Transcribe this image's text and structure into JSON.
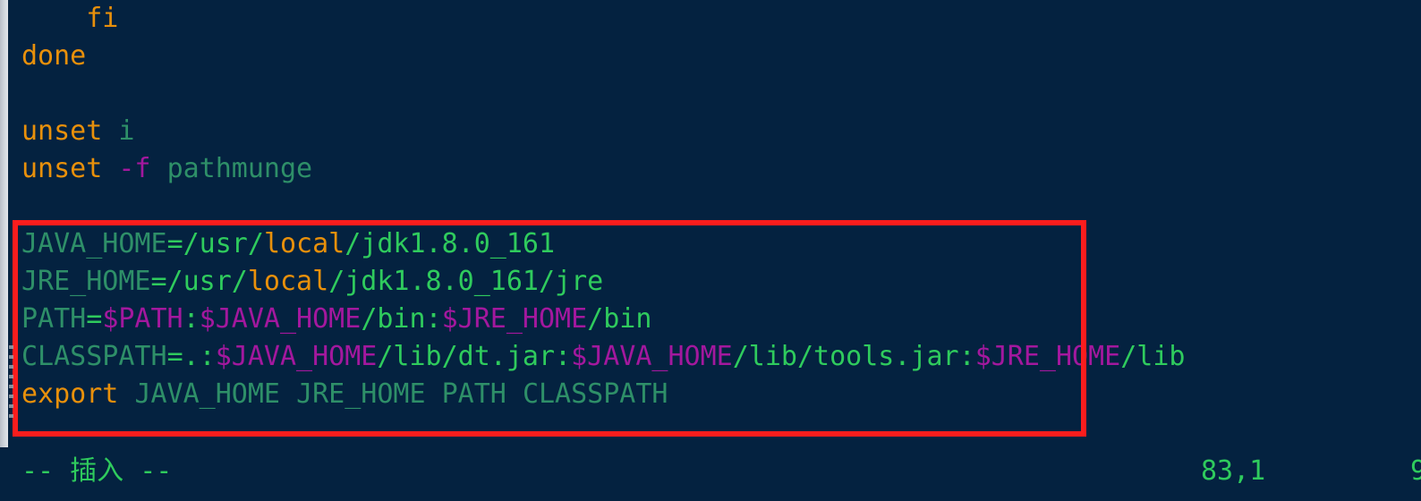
{
  "editor": {
    "app": "vim",
    "background_color": "#042240",
    "colors": {
      "keyword": "#e8900b",
      "identifier": "#2e8f68",
      "string": "#2fcb5d",
      "variable": "#a3189e",
      "annotation": "#fb1d1d",
      "scrollbar": "#c7ccd3"
    },
    "lines": [
      {
        "id": "line-fi",
        "indent": "    ",
        "tokens": [
          {
            "text": "fi",
            "kind": "keyword"
          }
        ]
      },
      {
        "id": "line-done",
        "indent": "",
        "tokens": [
          {
            "text": "done",
            "kind": "keyword"
          }
        ]
      },
      {
        "id": "line-blank-1",
        "indent": "",
        "tokens": []
      },
      {
        "id": "line-unset-i",
        "indent": "",
        "tokens": [
          {
            "text": "unset",
            "kind": "keyword"
          },
          {
            "text": " ",
            "kind": "plain"
          },
          {
            "text": "i",
            "kind": "identifier"
          }
        ]
      },
      {
        "id": "line-unset-f-pathmunge",
        "indent": "",
        "tokens": [
          {
            "text": "unset",
            "kind": "keyword"
          },
          {
            "text": " ",
            "kind": "plain"
          },
          {
            "text": "-f",
            "kind": "flag"
          },
          {
            "text": " ",
            "kind": "plain"
          },
          {
            "text": "pathmunge",
            "kind": "identifier"
          }
        ]
      },
      {
        "id": "line-blank-2",
        "indent": "",
        "tokens": []
      },
      {
        "id": "line-java-home",
        "indent": "",
        "tokens": [
          {
            "text": "JAVA_HOME",
            "kind": "identifier"
          },
          {
            "text": "=/usr/",
            "kind": "string"
          },
          {
            "text": "local",
            "kind": "keyword"
          },
          {
            "text": "/jdk1.8.0_161",
            "kind": "string"
          }
        ]
      },
      {
        "id": "line-jre-home",
        "indent": "",
        "tokens": [
          {
            "text": "JRE_HOME",
            "kind": "identifier"
          },
          {
            "text": "=/usr/",
            "kind": "string"
          },
          {
            "text": "local",
            "kind": "keyword"
          },
          {
            "text": "/jdk1.8.0_161/jre",
            "kind": "string"
          }
        ]
      },
      {
        "id": "line-path",
        "indent": "",
        "tokens": [
          {
            "text": "PATH",
            "kind": "identifier"
          },
          {
            "text": "=",
            "kind": "string"
          },
          {
            "text": "$PATH",
            "kind": "variable"
          },
          {
            "text": ":",
            "kind": "string"
          },
          {
            "text": "$JAVA_HOME",
            "kind": "variable"
          },
          {
            "text": "/bin:",
            "kind": "string"
          },
          {
            "text": "$JRE_HOME",
            "kind": "variable"
          },
          {
            "text": "/bin",
            "kind": "string"
          }
        ]
      },
      {
        "id": "line-classpath",
        "indent": "",
        "tokens": [
          {
            "text": "CLASSPATH",
            "kind": "identifier"
          },
          {
            "text": "=.:",
            "kind": "string"
          },
          {
            "text": "$JAVA_HOME",
            "kind": "variable"
          },
          {
            "text": "/lib/dt.jar:",
            "kind": "string"
          },
          {
            "text": "$JAVA_HOME",
            "kind": "variable"
          },
          {
            "text": "/lib/tools.jar:",
            "kind": "string"
          },
          {
            "text": "$JRE_HOME",
            "kind": "variable"
          },
          {
            "text": "/lib",
            "kind": "string"
          }
        ]
      },
      {
        "id": "line-export",
        "indent": "",
        "tokens": [
          {
            "text": "export",
            "kind": "keyword"
          },
          {
            "text": " ",
            "kind": "plain"
          },
          {
            "text": "JAVA_HOME",
            "kind": "identifier"
          },
          {
            "text": " ",
            "kind": "plain"
          },
          {
            "text": "JRE_HOME",
            "kind": "identifier"
          },
          {
            "text": " ",
            "kind": "plain"
          },
          {
            "text": "PATH",
            "kind": "identifier"
          },
          {
            "text": " ",
            "kind": "plain"
          },
          {
            "text": "CLASSPATH",
            "kind": "identifier"
          }
        ]
      }
    ]
  },
  "annotation": {
    "label": "red-highlight-rectangle",
    "color": "#fb1d1d"
  },
  "statusline": {
    "mode": "-- 插入 --",
    "position": "83,1",
    "percent": "9"
  }
}
